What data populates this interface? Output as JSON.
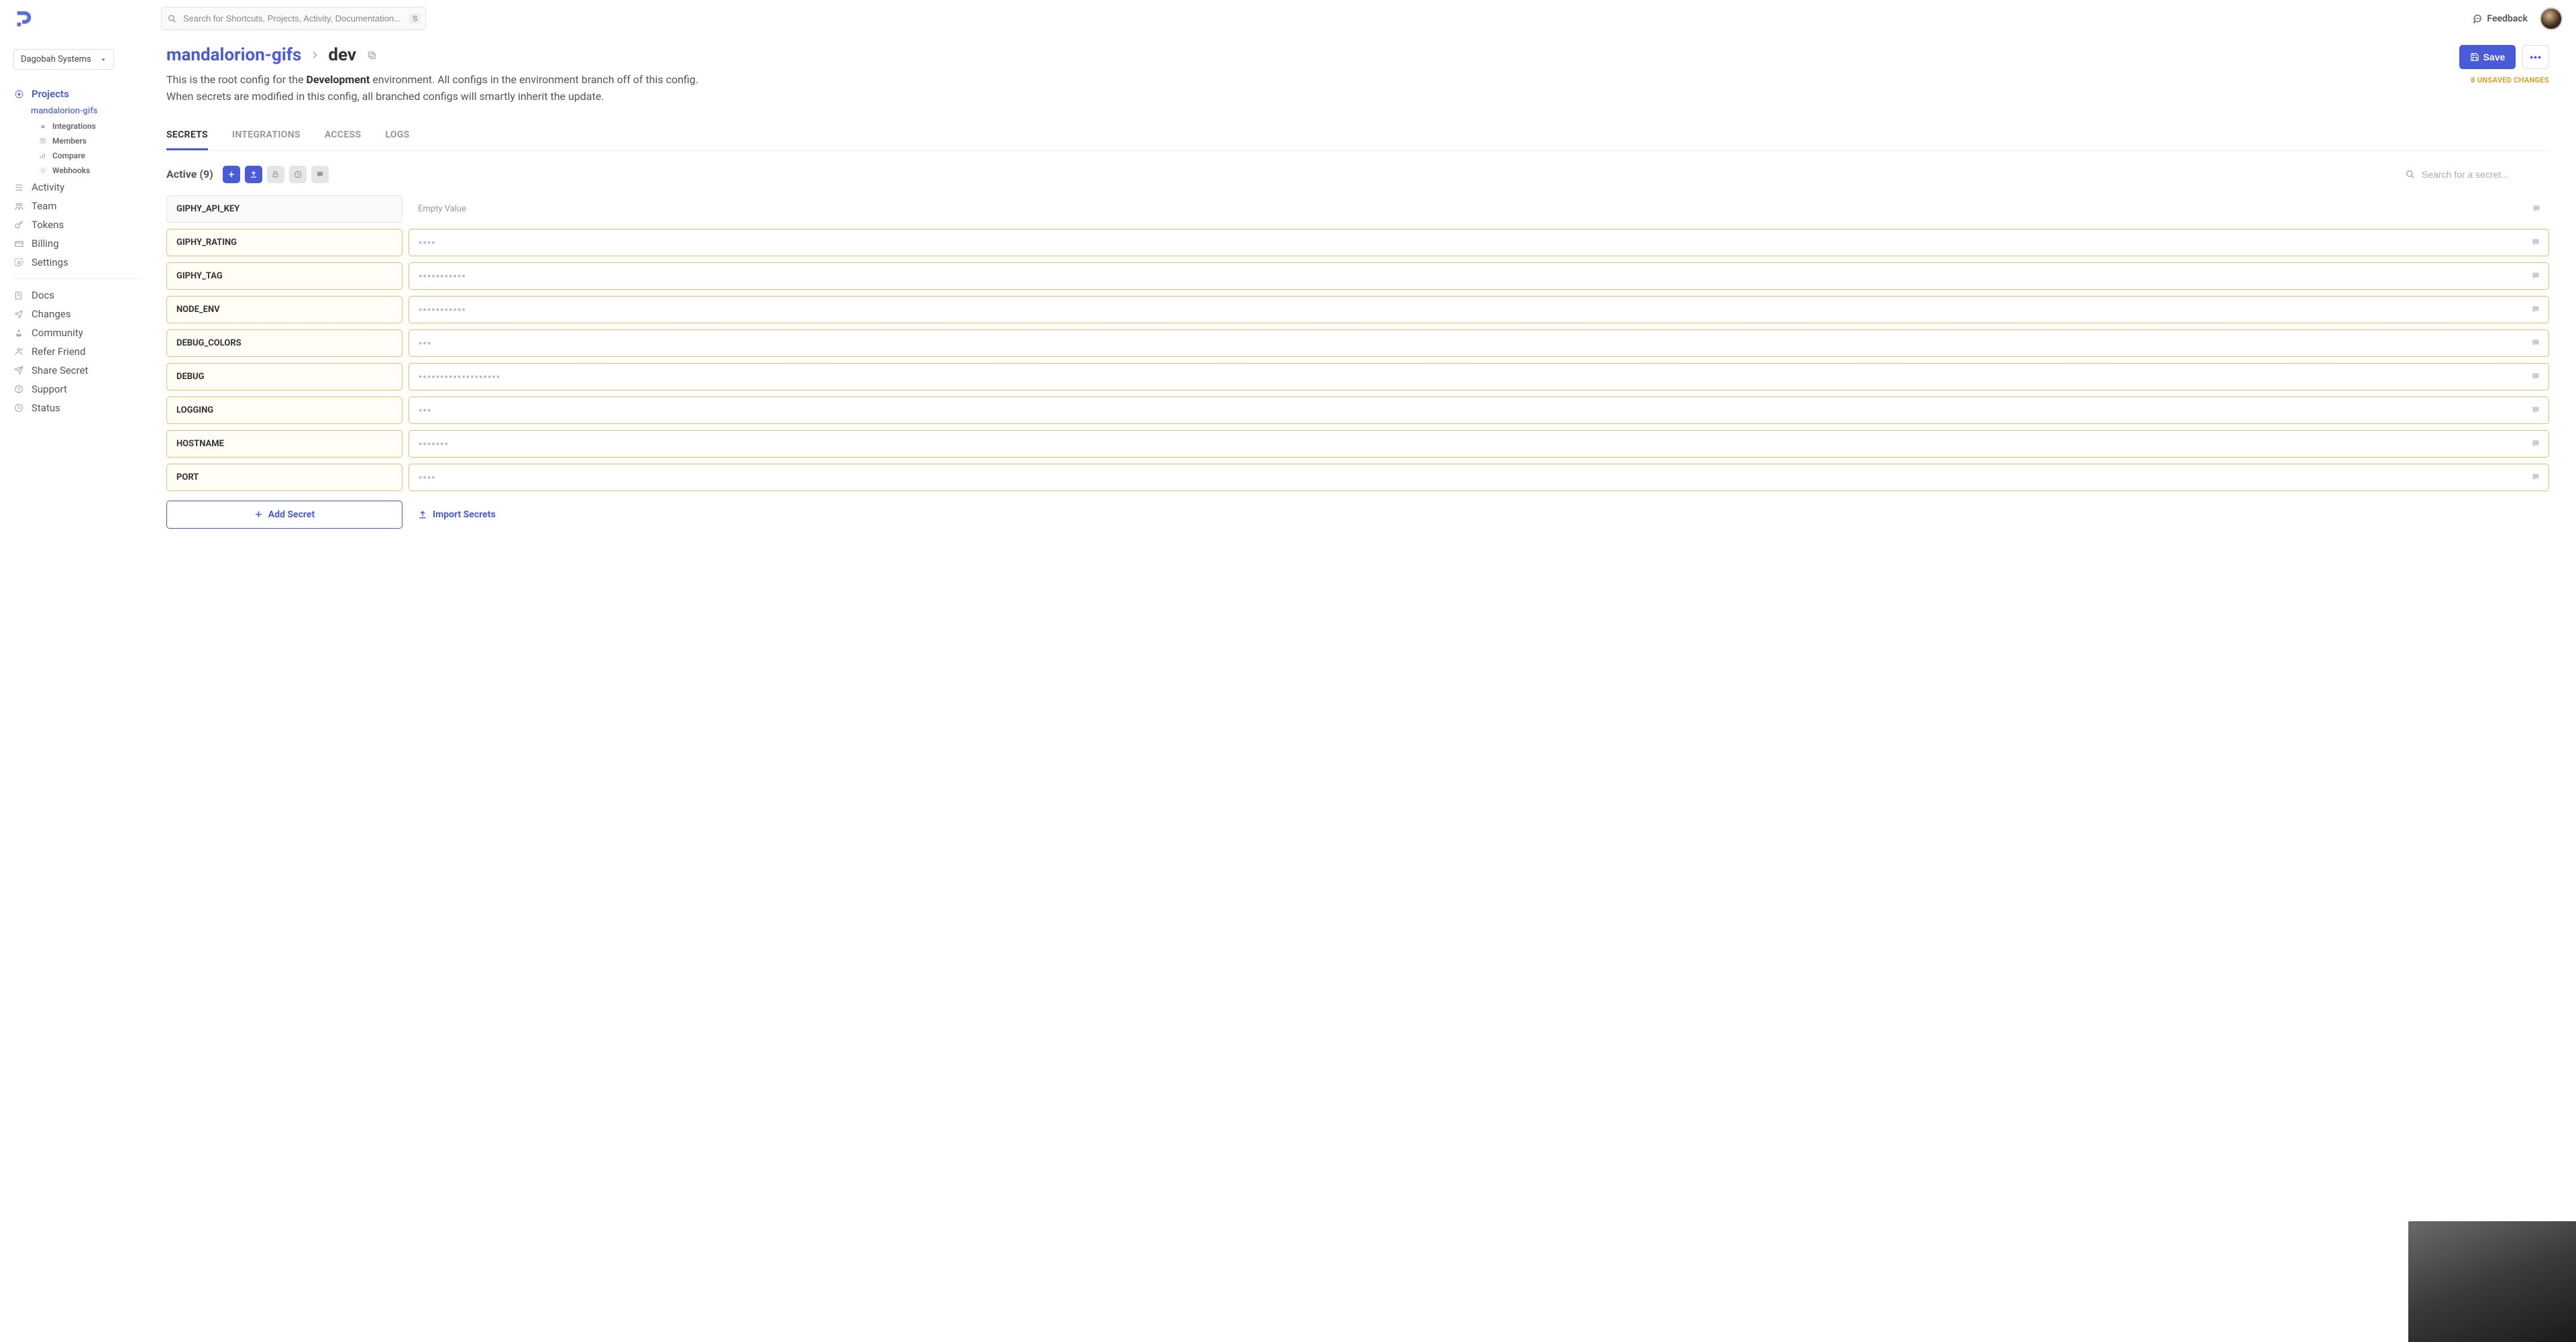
{
  "search": {
    "placeholder": "Search for Shortcuts, Projects, Activity, Documentation...",
    "key": "S"
  },
  "topbar": {
    "feedback": "Feedback"
  },
  "org": {
    "name": "Dagobah Systems"
  },
  "sidebar": {
    "projects_label": "Projects",
    "current_project": "mandalorion-gifs",
    "project_sub": [
      {
        "label": "Integrations"
      },
      {
        "label": "Members"
      },
      {
        "label": "Compare"
      },
      {
        "label": "Webhooks"
      }
    ],
    "items": [
      {
        "label": "Activity"
      },
      {
        "label": "Team"
      },
      {
        "label": "Tokens"
      },
      {
        "label": "Billing"
      },
      {
        "label": "Settings"
      }
    ],
    "secondary": [
      {
        "label": "Docs"
      },
      {
        "label": "Changes"
      },
      {
        "label": "Community"
      },
      {
        "label": "Refer Friend"
      },
      {
        "label": "Share Secret"
      },
      {
        "label": "Support"
      },
      {
        "label": "Status"
      }
    ]
  },
  "header": {
    "project": "mandalorion-gifs",
    "env": "dev",
    "desc_pre": "This is the root config for the ",
    "desc_bold": "Development",
    "desc_post": " environment. All configs in the environment branch off of this config. When secrets are modified in this config, all branched configs will smartly inherit the update.",
    "save": "Save",
    "more": "•••",
    "unsaved": "8 UNSAVED CHANGES"
  },
  "tabs": [
    {
      "label": "SECRETS",
      "active": true
    },
    {
      "label": "INTEGRATIONS"
    },
    {
      "label": "ACCESS"
    },
    {
      "label": "LOGS"
    }
  ],
  "toolbar": {
    "active_label": "Active (9)",
    "search_placeholder": "Search for a secret..."
  },
  "secrets": [
    {
      "key": "GIPHY_API_KEY",
      "value": "Empty Value",
      "empty": true,
      "modified": false
    },
    {
      "key": "GIPHY_RATING",
      "dots": 4,
      "modified": true
    },
    {
      "key": "GIPHY_TAG",
      "dots": 11,
      "modified": true
    },
    {
      "key": "NODE_ENV",
      "dots": 11,
      "modified": true
    },
    {
      "key": "DEBUG_COLORS",
      "dots": 3,
      "modified": true
    },
    {
      "key": "DEBUG",
      "dots": 19,
      "modified": true
    },
    {
      "key": "LOGGING",
      "dots": 3,
      "modified": true
    },
    {
      "key": "HOSTNAME",
      "dots": 7,
      "modified": true
    },
    {
      "key": "PORT",
      "dots": 4,
      "modified": true
    }
  ],
  "footer": {
    "add": "Add Secret",
    "import": "Import Secrets"
  }
}
